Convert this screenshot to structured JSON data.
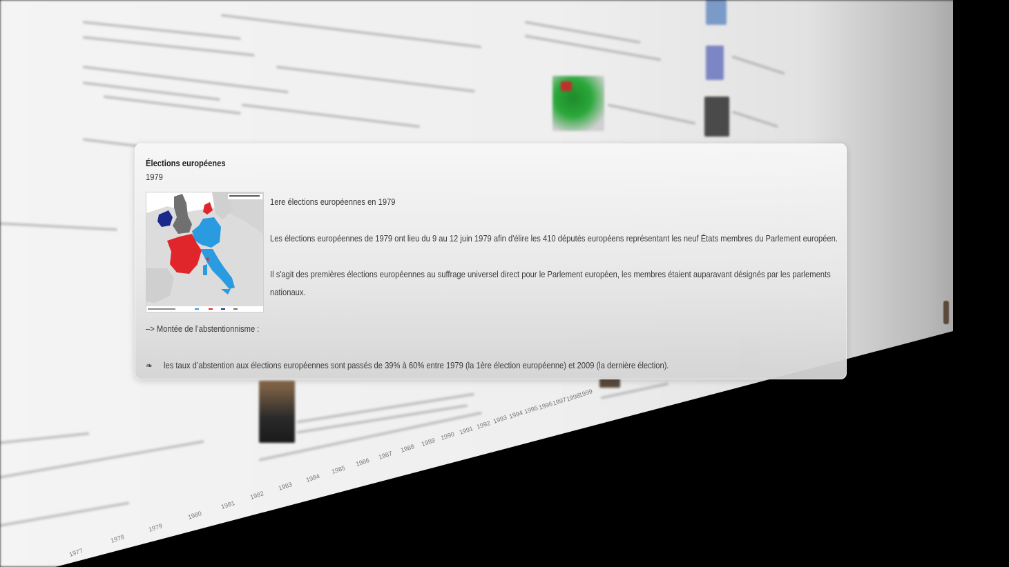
{
  "popup": {
    "title": "Élections européenes",
    "year": "1979",
    "image_icon": "europe-election-map-1979",
    "paragraphs": [
      "1ere élections européennes en 1979",
      "Les élections européennes de 1979 ont lieu du 9 au 12 juin 1979 afin d'élire les 410 députés européens représentant les neuf États membres du Parlement européen.",
      "Il s'agit des premières élections européennes au suffrage universel direct pour le Parlement européen, les membres étaient auparavant désignés par les parlements",
      "nationaux."
    ],
    "abstention_heading": "–> Montée de l’abstentionnisme :",
    "bullet_glyph": "❧",
    "bullet_text": "les taux d’abstention aux élections européennes sont passés de 39% à  60% entre 1979 (la 1ère élection européenne) et 2009 (la dernière  élection)."
  },
  "colors": {
    "map_red": "#e0262a",
    "map_blue": "#2a9be0",
    "map_darkblue": "#1b2a8a",
    "map_green": "#1a7a2a",
    "map_grey": "#6e6e6e",
    "map_land": "#d8d8d8"
  }
}
